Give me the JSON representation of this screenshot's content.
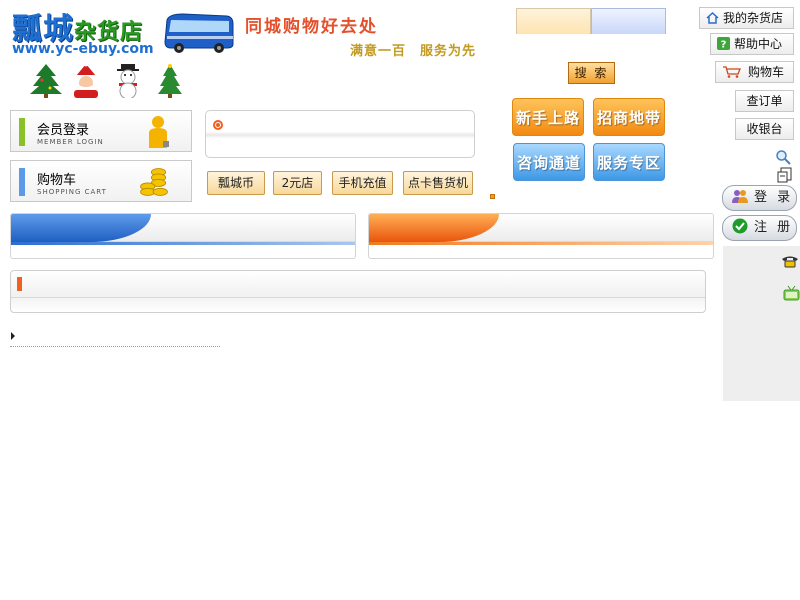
{
  "header": {
    "logo_name": "瓢城",
    "logo_suffix": "杂货店",
    "logo_url": "www.yc-ebuy.com",
    "slogan_main": "同城购物好去处",
    "slogan_sub": "满意一百　服务为先"
  },
  "member_box": {
    "title": "会员登录",
    "subtitle": "MEMBER LOGIN"
  },
  "cart_box": {
    "title": "购物车",
    "subtitle": "SHOPPING CART"
  },
  "quick_links": [
    "瓢城币",
    "2元店",
    "手机充值",
    "点卡售货机"
  ],
  "search": {
    "button": "搜 索"
  },
  "feature_buttons": [
    "新手上路",
    "招商地带",
    "咨询通道",
    "服务专区"
  ],
  "right_nav": [
    "我的杂货店",
    "帮助中心",
    "购物车",
    "查订单",
    "收银台"
  ],
  "auth": {
    "login": "登 录",
    "register": "注 册"
  },
  "colors": {
    "accent_orange": "#f18a12",
    "accent_blue": "#3d98e6",
    "brand_blue": "#1f6fd1",
    "brand_green": "#2a9a25",
    "slogan_red": "#e4502b"
  }
}
